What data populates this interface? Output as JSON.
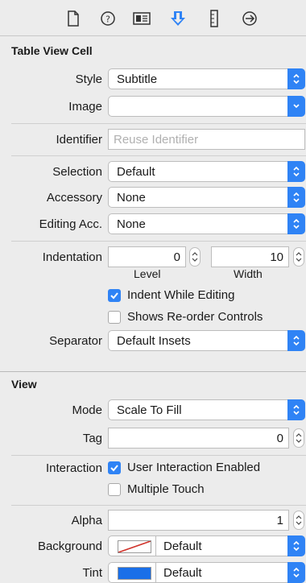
{
  "toolbar": {
    "tabs": [
      {
        "icon": "file-inspector-icon"
      },
      {
        "icon": "quick-help-icon"
      },
      {
        "icon": "identity-inspector-icon"
      },
      {
        "icon": "attributes-inspector-icon",
        "selected": true
      },
      {
        "icon": "size-inspector-icon"
      },
      {
        "icon": "connections-inspector-icon"
      }
    ],
    "accent": "#2f83f5"
  },
  "table_view_cell": {
    "title": "Table View Cell",
    "style": {
      "label": "Style",
      "value": "Subtitle"
    },
    "image": {
      "label": "Image",
      "value": ""
    },
    "identifier": {
      "label": "Identifier",
      "placeholder": "Reuse Identifier"
    },
    "selection": {
      "label": "Selection",
      "value": "Default"
    },
    "accessory": {
      "label": "Accessory",
      "value": "None"
    },
    "editing_acc": {
      "label": "Editing Acc.",
      "value": "None"
    },
    "indentation": {
      "label": "Indentation",
      "level": {
        "value": "0",
        "caption": "Level"
      },
      "width": {
        "value": "10",
        "caption": "Width"
      }
    },
    "indent_while_editing": {
      "label": "Indent While Editing",
      "checked": true
    },
    "shows_reorder": {
      "label": "Shows Re-order Controls",
      "checked": false
    },
    "separator": {
      "label": "Separator",
      "value": "Default Insets"
    }
  },
  "view": {
    "title": "View",
    "mode": {
      "label": "Mode",
      "value": "Scale To Fill"
    },
    "tag": {
      "label": "Tag",
      "value": "0"
    },
    "interaction": {
      "label": "Interaction"
    },
    "user_interaction": {
      "label": "User Interaction Enabled",
      "checked": true
    },
    "multiple_touch": {
      "label": "Multiple Touch",
      "checked": false
    },
    "alpha": {
      "label": "Alpha",
      "value": "1"
    },
    "background": {
      "label": "Background",
      "value": "Default"
    },
    "tint": {
      "label": "Tint",
      "value": "Default",
      "swatch_color": "#1a6fe8"
    }
  }
}
